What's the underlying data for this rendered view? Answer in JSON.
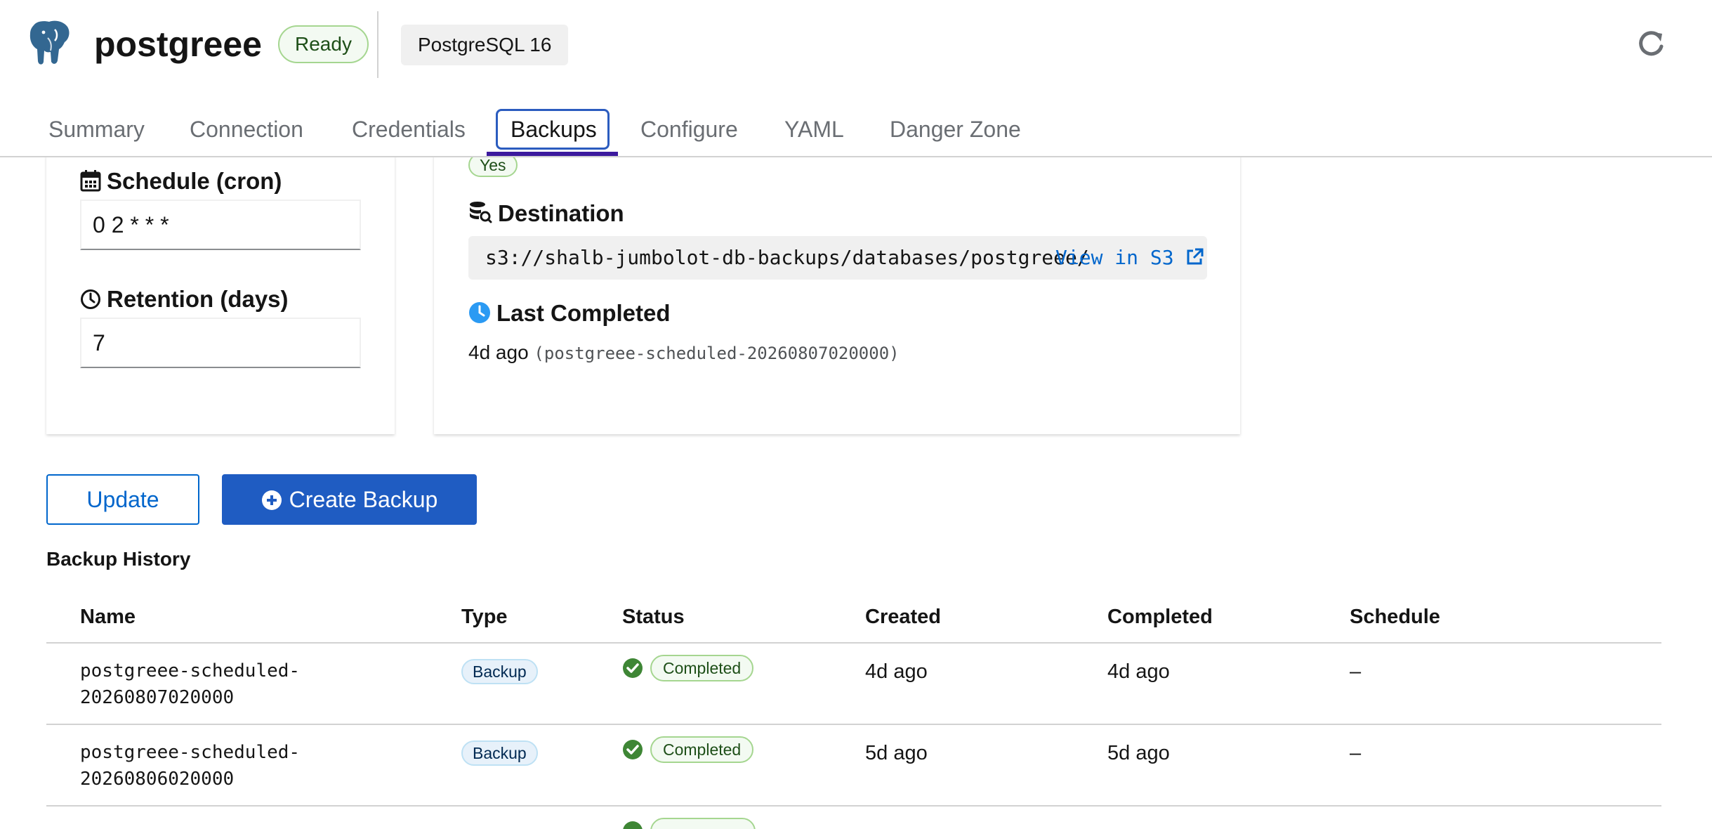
{
  "header": {
    "title": "postgreee",
    "status_badge": "Ready",
    "version_badge": "PostgreSQL 16",
    "refresh_icon": "refresh-icon",
    "logo_icon": "postgresql-elephant-logo"
  },
  "tabs": [
    {
      "label": "Summary",
      "active": false
    },
    {
      "label": "Connection",
      "active": false
    },
    {
      "label": "Credentials",
      "active": false
    },
    {
      "label": "Backups",
      "active": true
    },
    {
      "label": "Configure",
      "active": false
    },
    {
      "label": "YAML",
      "active": false
    },
    {
      "label": "Danger Zone",
      "active": false
    }
  ],
  "schedule": {
    "label": "Schedule (cron)",
    "value": "0 2 * * *",
    "icon": "calendar-icon"
  },
  "retention": {
    "label": "Retention (days)",
    "value": "7",
    "icon": "clock-icon"
  },
  "enabled_value": "Yes",
  "destination": {
    "label": "Destination",
    "path": "s3://shalb-jumbolot-db-backups/databases/postgreee/",
    "link": "View in S3",
    "icon": "database-search-icon"
  },
  "last_completed": {
    "label": "Last Completed",
    "ago": "4d ago",
    "backup_name": "(postgreee-scheduled-20260807020000)",
    "icon": "clock-filled-icon"
  },
  "actions": {
    "update": "Update",
    "create_backup": "Create Backup"
  },
  "history": {
    "title": "Backup History",
    "columns": [
      "Name",
      "Type",
      "Status",
      "Created",
      "Completed",
      "Schedule"
    ],
    "rows": [
      {
        "name": "postgreee-scheduled-20260807020000",
        "type": "Backup",
        "status": "Completed",
        "created": "4d ago",
        "completed": "4d ago",
        "schedule": "–"
      },
      {
        "name": "postgreee-scheduled-20260806020000",
        "type": "Backup",
        "status": "Completed",
        "created": "5d ago",
        "completed": "5d ago",
        "schedule": "–"
      }
    ]
  },
  "colors": {
    "primary": "#1f5cc2",
    "link": "#0066cc",
    "success": "#3e8635",
    "active_tab_underline": "#3c1a9e"
  }
}
